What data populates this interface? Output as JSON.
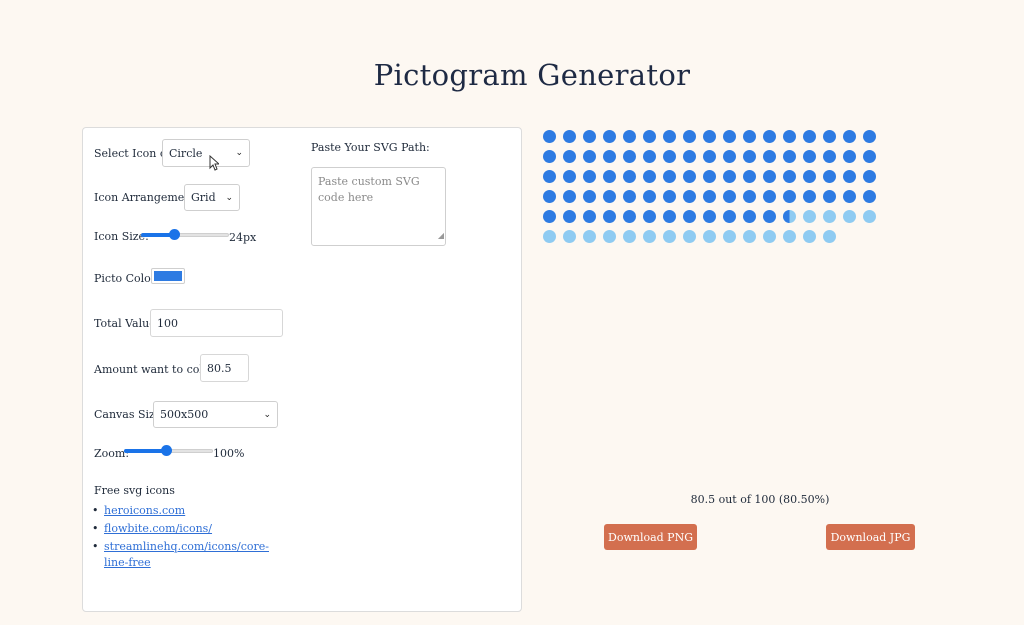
{
  "page": {
    "title": "Pictogram Generator"
  },
  "controls": {
    "select_icon_label": "Select Icon or:",
    "select_icon_value": "Circle",
    "arrangement_label": "Icon Arrangement:",
    "arrangement_value": "Grid",
    "icon_size_label": "Icon Size:",
    "icon_size_value": "24px",
    "icon_size_level": 0.38,
    "picto_color_label": "Picto Color:",
    "picto_color": "#2e7be2",
    "total_value_label": "Total Value:",
    "total_value": "100",
    "amount_label": "Amount want to color:",
    "amount_value": "80.5",
    "canvas_size_label": "Canvas Size:",
    "canvas_size_value": "500x500",
    "zoom_label": "Zoom:",
    "zoom_value": "100%",
    "zoom_level": 0.47,
    "svg_path_label": "Paste Your SVG Path:",
    "svg_placeholder": "Paste custom SVG code here"
  },
  "free_icons": {
    "heading": "Free svg icons",
    "links": [
      "heroicons.com",
      "flowbite.com/icons/",
      "streamlinehq.com/icons/core-line-free"
    ]
  },
  "pictogram": {
    "total": 100,
    "colored": 80.5,
    "columns": 17,
    "active_color": "#2e7be2",
    "inactive_color": "#8fcbf2",
    "summary": "80.5 out of 100 (80.50%)"
  },
  "buttons": {
    "download_png": "Download PNG",
    "download_jpg": "Download JPG"
  }
}
